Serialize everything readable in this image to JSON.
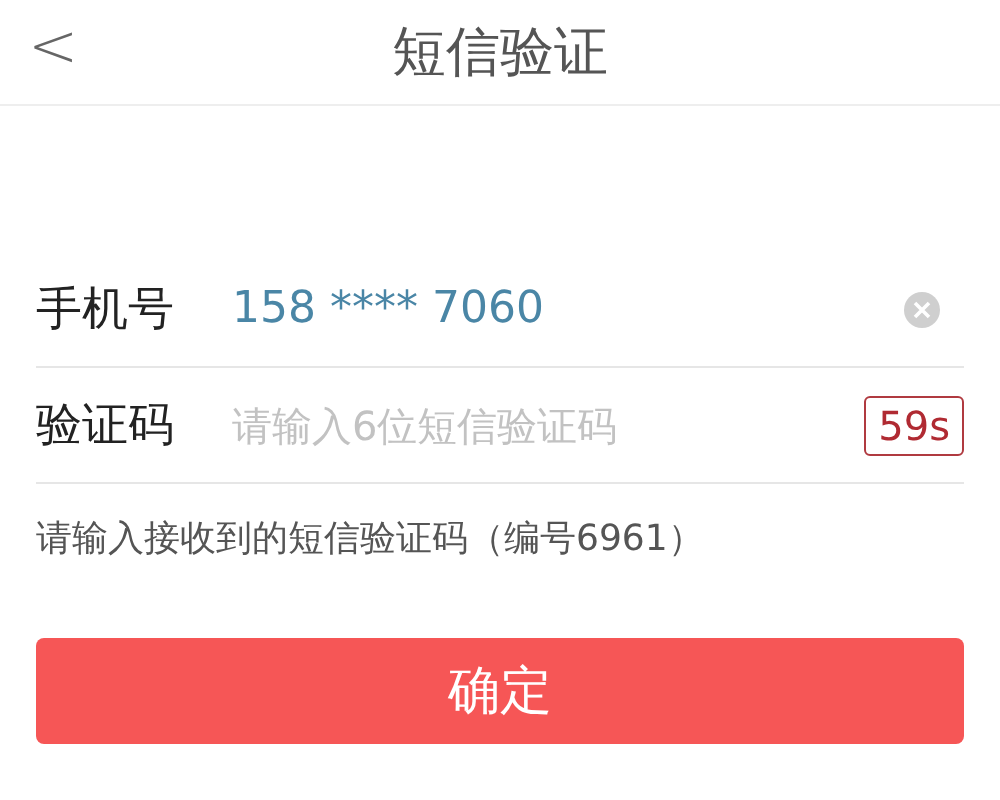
{
  "header": {
    "back": "<",
    "title": "短信验证"
  },
  "phone": {
    "label": "手机号",
    "value": "158 **** 7060"
  },
  "code": {
    "label": "验证码",
    "placeholder": "请输入6位短信验证码",
    "countdown": "59s"
  },
  "hint": "请输入接收到的短信验证码（编号6961）",
  "confirm": "确定"
}
